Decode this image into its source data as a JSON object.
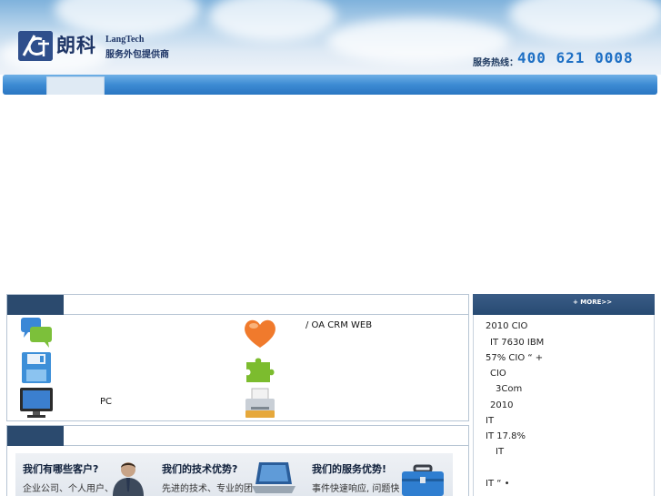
{
  "header": {
    "brand_cn": "朗科",
    "brand_en": "LangTech",
    "brand_sub": "服务外包提供商",
    "hotline_label": "服务热线：",
    "hotline_number": "400 621 0008"
  },
  "more_link": "+ MORE>>",
  "services": {
    "item_pc": "PC",
    "item_chain": "/          OA          CRM  WEB"
  },
  "news": [
    "2010 CIO",
    "IT     7630     IBM",
    "57% CIO   “ +",
    "CIO",
    "3Com",
    "2010",
    "IT",
    "IT           17.8%",
    "IT",
    "IT      “   •"
  ],
  "banner": {
    "q1_title": "我们有哪些客户?",
    "q1_text": "企业公司、个人用户、",
    "q2_title": "我们的技术优势?",
    "q2_text": "先进的技术、专业的团",
    "q3_title": "我们的服务优势!",
    "q3_text": "事件快速响应, 问题快"
  },
  "icons": {
    "logo": "langtech-logo-icon",
    "chat": "chat-bubbles-icon",
    "save": "floppy-disk-icon",
    "monitor": "monitor-icon",
    "heart": "heart-icon",
    "puzzle": "puzzle-piece-icon",
    "printer": "printer-icon",
    "person": "businessman-icon",
    "laptop": "laptop-icon",
    "toolbox": "toolbox-icon"
  }
}
